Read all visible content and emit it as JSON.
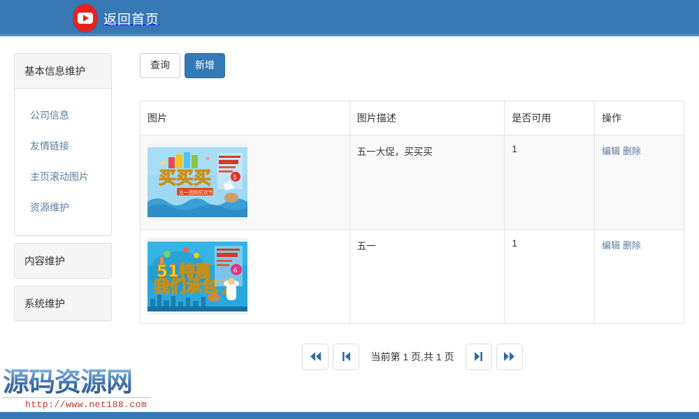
{
  "header": {
    "logo_icon": "play-button-icon",
    "title": "返回首页"
  },
  "sidebar": {
    "panels": [
      {
        "title": "基本信息维护",
        "expanded": true,
        "items": [
          {
            "label": "公司信息"
          },
          {
            "label": "友情链接"
          },
          {
            "label": "主页滚动图片"
          },
          {
            "label": "资源维护"
          }
        ]
      },
      {
        "title": "内容维护",
        "expanded": false,
        "items": []
      },
      {
        "title": "系统维护",
        "expanded": false,
        "items": []
      }
    ]
  },
  "toolbar": {
    "query_label": "查询",
    "add_label": "新增"
  },
  "table": {
    "columns": [
      "图片",
      "图片描述",
      "是否可用",
      "操作"
    ],
    "rows": [
      {
        "image_alt": "五一大促买买买促销横幅",
        "description": "五一大促，买买买",
        "available": "1",
        "edit_label": "编辑",
        "delete_label": "删除"
      },
      {
        "image_alt": "51特惠我们承包了促销横幅",
        "description": "五一",
        "available": "1",
        "edit_label": "编辑",
        "delete_label": "删除"
      }
    ]
  },
  "pagination": {
    "first_icon": "⏮",
    "prev_icon": "◀|",
    "info": "当前第 1 页,共 1 页",
    "next_icon": "|▶",
    "last_icon": "⏭"
  },
  "watermark": {
    "title": "源码资源网",
    "url": "http://www.net188.com"
  },
  "colors": {
    "header_blue": "#3778b5",
    "primary_blue": "#337ab7",
    "link_blue": "#5c7d9e",
    "logo_red": "#e8231e",
    "watermark_red": "#c0392b"
  }
}
